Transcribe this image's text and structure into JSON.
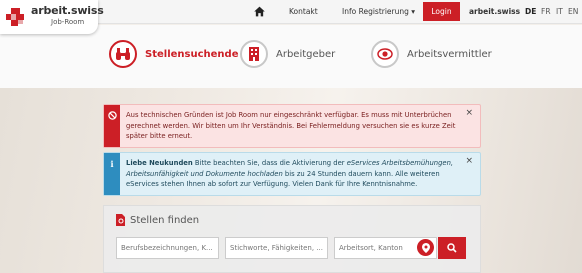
{
  "header": {
    "logo": {
      "title": "arbeit.swiss",
      "subtitle": "Job-Room"
    },
    "nav": {
      "kontakt": "Kontakt",
      "info": "Info Registrierung ▾",
      "login": "Login",
      "brand": "arbeit.swiss"
    },
    "languages": [
      "DE",
      "FR",
      "IT",
      "EN"
    ],
    "active_language": "DE"
  },
  "categories": [
    {
      "label": "Stellensuchende",
      "icon": "binoculars-icon",
      "active": true
    },
    {
      "label": "Arbeitgeber",
      "icon": "building-icon",
      "active": false
    },
    {
      "label": "Arbeitsvermittler",
      "icon": "eye-icon",
      "active": false
    }
  ],
  "alerts": {
    "danger": {
      "text": "Aus technischen Gründen ist Job Room nur eingeschränkt verfügbar. Es muss mit Unterbrüchen gerechnet werden. Wir bitten um Ihr Verständnis. Bei Fehlermeldung versuchen sie es kurze Zeit später bitte erneut.",
      "close": "×"
    },
    "info": {
      "bold": "Liebe Neukunden",
      "text1": " Bitte beachten Sie, dass die Aktivierung der ",
      "italic": "eServices Arbeitsbemühungen, Arbeitsunfähigkeit und Dokumente hochladen",
      "text2": " bis zu 24 Stunden dauern kann. Alle weiteren eServices stehen Ihnen ab sofort zur Verfügung. Vielen Dank für Ihre Kenntnisnahme.",
      "close": "×"
    }
  },
  "search": {
    "title": "Stellen finden",
    "fields": {
      "occupation_placeholder": "Berufsbezeichnungen, K...",
      "keywords_placeholder": "Stichworte, Fähigkeiten, ...",
      "location_placeholder": "Arbeitsort, Kanton"
    }
  },
  "colors": {
    "accent": "#cc1f26",
    "info": "#2e8dbf"
  }
}
